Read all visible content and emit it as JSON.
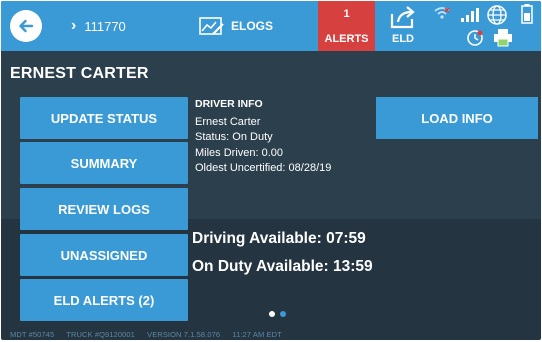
{
  "topbar": {
    "truck_id": "111770",
    "elogs_label": "ELOGS",
    "alerts_count": "1",
    "alerts_label": "ALERTS",
    "eld_label": "ELD",
    "icons": [
      "wifi-icon",
      "signal-icon",
      "globe-icon",
      "battery-icon",
      "clock-icon",
      "printer-icon"
    ],
    "alert_color": "#d6413f",
    "accent_color": "#3a9ad6"
  },
  "driver": {
    "name": "ERNEST CARTER"
  },
  "menu": {
    "update_status": "UPDATE STATUS",
    "summary": "SUMMARY",
    "review_logs": "REVIEW LOGS",
    "unassigned": "UNASSIGNED",
    "eld_alerts": "ELD ALERTS (2)",
    "load_info": "LOAD INFO"
  },
  "driver_info": {
    "heading": "DRIVER INFO",
    "name": "Ernest Carter",
    "status": "Status: On Duty",
    "miles": "Miles Driven: 0.00",
    "oldest_uncertified": "Oldest Uncertified: 08/28/19"
  },
  "availability": {
    "driving": "Driving Available: 07:59",
    "on_duty": "On Duty Available: 13:59"
  },
  "pager": {
    "current_page": 1,
    "page_count": 2
  },
  "footer": {
    "mdt": "MDT #50745",
    "truck": "TRUCK #Q9120001",
    "version": "VERSION  7.1.58.076",
    "time": "11:27 AM EDT"
  }
}
